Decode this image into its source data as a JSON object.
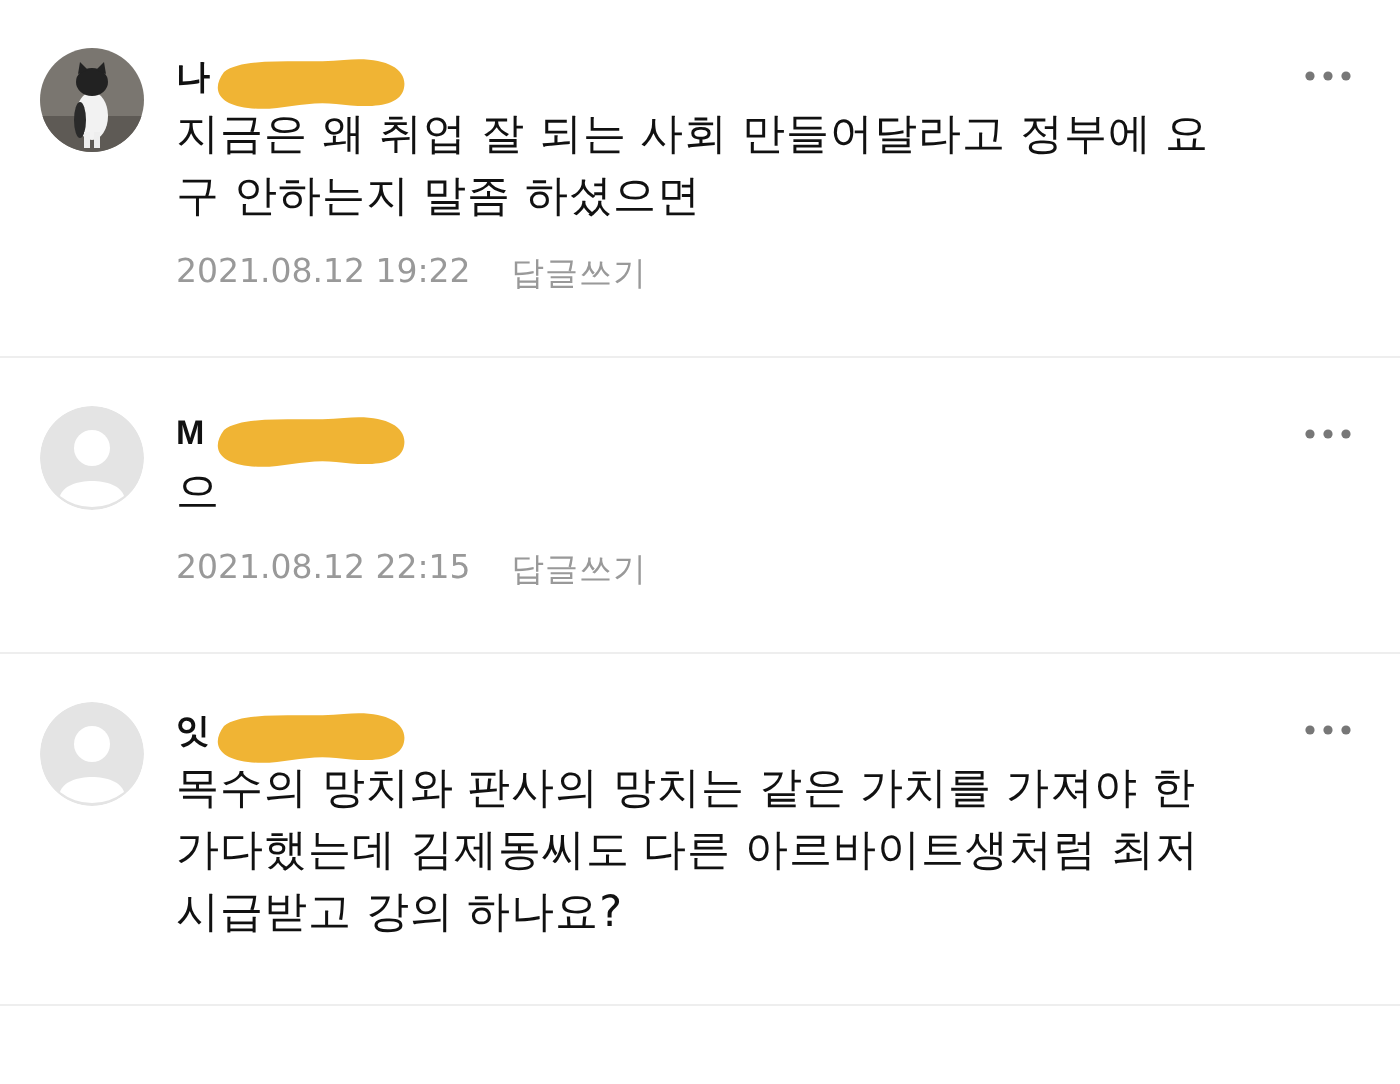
{
  "comments": [
    {
      "name": "나",
      "redacted": true,
      "lines": [
        "지금은 왜 취업 잘 되는 사회 만들어달라고 정부에 요",
        "구 안하는지 말좀 하셨으면"
      ],
      "time": "2021.08.12 19:22",
      "reply": "답글쓰기"
    },
    {
      "kind": "default",
      "name": "M",
      "redacted": true,
      "lines": [
        "으"
      ],
      "time": "2021.08.12 22:15",
      "reply": "답글쓰기"
    },
    {
      "kind": "default",
      "name": "잇",
      "redacted": true,
      "lines": [
        "목수의 망치와 판사의 망치는 같은 가치를 가져야 한",
        "가다했는데 김제동씨도 다른 아르바이트생처럼 최저",
        "시급받고 강의 하나요?"
      ]
    }
  ]
}
